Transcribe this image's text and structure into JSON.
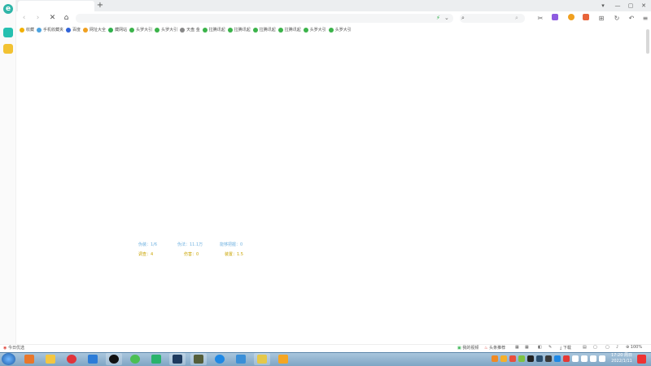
{
  "sidebar": {
    "logo_letter": "e"
  },
  "tabs": {
    "new_tab": "+"
  },
  "toolbar": {
    "stop": "✕",
    "home": "⌂",
    "back": "‹",
    "forward": "›",
    "search_glyph": "⌕"
  },
  "bookmarks": [
    {
      "label": "收藏",
      "icon_color": "#f2b000"
    },
    {
      "label": "手机收藏夹",
      "icon_color": "#4da3e0"
    },
    {
      "label": "百度",
      "icon_color": "#3063d8"
    },
    {
      "label": "网址大全",
      "icon_color": "#f0a020"
    },
    {
      "label": "藏网站",
      "icon_color": "#2fb14b"
    },
    {
      "label": "头罗大引",
      "icon_color": "#3bb34a"
    },
    {
      "label": "头罗大引",
      "icon_color": "#3bb34a"
    },
    {
      "label": "天盘 金",
      "icon_color": "#888888"
    },
    {
      "label": "拉腾讯起",
      "icon_color": "#3bb34a"
    },
    {
      "label": "拉腾讯起",
      "icon_color": "#3bb34a"
    },
    {
      "label": "拉腾讯起",
      "icon_color": "#3bb34a"
    },
    {
      "label": "拉腾讯起",
      "icon_color": "#3bb34a"
    },
    {
      "label": "头罗大引",
      "icon_color": "#3bb34a"
    },
    {
      "label": "头罗大引",
      "icon_color": "#3bb34a"
    }
  ],
  "stats": {
    "row1": [
      "伪装：1/6",
      "伪法：11.1万",
      "能够把握：0"
    ],
    "row2": [
      "调查：4",
      "伤害：0",
      "装置：1.5"
    ]
  },
  "statusbar": {
    "left": "今日优选",
    "video": "我的视频",
    "news": "头条推荐",
    "download": "下载",
    "zoom": "100%"
  },
  "clock": {
    "time": "17:20 周日",
    "date": "2022/1/11"
  },
  "colors": {
    "accent": "#2fb5a8",
    "stat_blue": "#6fb1e0",
    "stat_yellow": "#c9a400"
  }
}
